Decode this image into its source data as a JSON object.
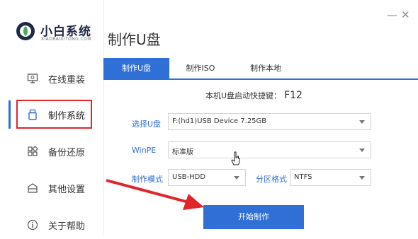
{
  "app": {
    "name": "小白系统",
    "subtitle": "XIAOBAIXITONG.COM"
  },
  "window_controls": {
    "minimize": "—",
    "close": "✕"
  },
  "sidebar": {
    "items": [
      {
        "label": "在线重装",
        "icon": "monitor-icon"
      },
      {
        "label": "制作系统",
        "icon": "usb-drive-icon",
        "active": true
      },
      {
        "label": "备份还原",
        "icon": "grid-icon"
      },
      {
        "label": "其他设置",
        "icon": "box-icon"
      },
      {
        "label": "关于帮助",
        "icon": "info-icon"
      }
    ]
  },
  "page_title": "制作U盘",
  "tabs": [
    {
      "label": "制作U盘",
      "active": true
    },
    {
      "label": "制作ISO",
      "active": false
    },
    {
      "label": "制作本地",
      "active": false
    }
  ],
  "hotkey": {
    "label": "本机U盘启动快捷键：",
    "key": "F12"
  },
  "form": {
    "usb_label": "选择U盘",
    "usb_value": "F:(hd1)USB Device 7.25GB",
    "winpe_label": "WinPE",
    "winpe_value": "标准版",
    "mode_label": "制作模式",
    "mode_value": "USB-HDD",
    "partition_label": "分区格式",
    "partition_value": "NTFS"
  },
  "start_button": "开始制作",
  "colors": {
    "accent": "#2f6fd6",
    "highlight": "#e0262b",
    "annotation_arrow": "#e0262b"
  }
}
